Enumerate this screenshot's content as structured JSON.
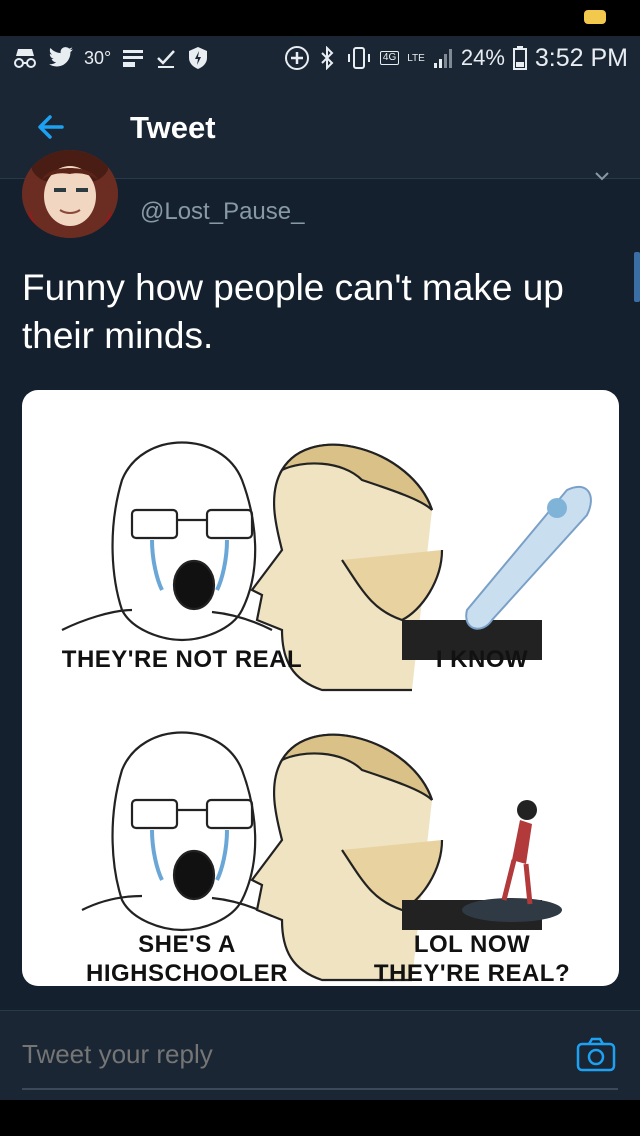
{
  "status_bar": {
    "temperature": "30°",
    "network_badge": "4G",
    "lte": "LTE",
    "battery": "24%",
    "time": "3:52 PM",
    "icons_left": [
      "incognito-icon",
      "twitter-icon",
      "weather-icon",
      "download-icon",
      "check-icon",
      "shield-icon"
    ],
    "icons_right": [
      "add-circle-icon",
      "bluetooth-icon",
      "vibrate-icon",
      "signal-icon",
      "battery-icon"
    ]
  },
  "header": {
    "title": "Tweet",
    "back_icon": "arrow-left-icon"
  },
  "tweet": {
    "handle": "@Lost_Pause_",
    "text": "Funny how people can't make up their minds."
  },
  "meme": {
    "caption_top_left": "THEY'RE NOT REAL",
    "caption_top_right": "I KNOW",
    "caption_bottom_left_line1": "SHE'S A",
    "caption_bottom_left_line2": "HIGHSCHOOLER",
    "caption_bottom_right_line1": "LOL NOW",
    "caption_bottom_right_line2": "THEY'RE REAL?"
  },
  "reply": {
    "placeholder": "Tweet your reply",
    "camera_icon": "camera-icon"
  },
  "colors": {
    "background": "#14202d",
    "accent": "#1da1f2",
    "muted": "#8899a6"
  }
}
